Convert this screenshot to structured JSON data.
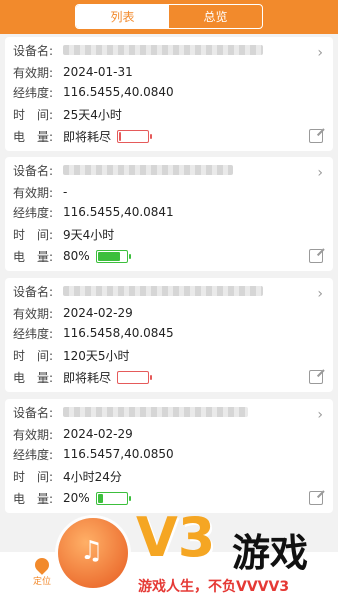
{
  "tabs": [
    {
      "label": "列表",
      "active": true
    },
    {
      "label": "总览",
      "active": false
    }
  ],
  "labels": {
    "device": "设备名:",
    "expiry": "有效期:",
    "coords": "经纬度:",
    "time": "时　间:",
    "battery": "电　量:"
  },
  "devices": [
    {
      "expiry": "2024-01-31",
      "coords": "116.5455,40.0840",
      "time": "25天4小时",
      "battery_text": "即将耗尽",
      "battery_level": 0.08,
      "battery_color": "#e55a5a"
    },
    {
      "expiry": "-",
      "coords": "116.5455,40.0841",
      "time": "9天4小时",
      "battery_text": "80%",
      "battery_level": 0.8,
      "battery_color": "#3cbf3c"
    },
    {
      "expiry": "2024-02-29",
      "coords": "116.5458,40.0845",
      "time": "120天5小时",
      "battery_text": "即将耗尽",
      "battery_level": 0.0,
      "battery_color": "#e55a5a"
    },
    {
      "expiry": "2024-02-29",
      "coords": "116.5457,40.0850",
      "time": "4小时24分",
      "battery_text": "20%",
      "battery_level": 0.2,
      "battery_color": "#3cbf3c"
    }
  ],
  "nav": {
    "locate_label": "定位"
  },
  "watermark": {
    "brand": "V3",
    "title": "游戏",
    "slogan": "游戏人生，不负VVVV3"
  },
  "colors": {
    "accent": "#f28a2c",
    "low_battery": "#e55a5a",
    "ok_battery": "#3cbf3c"
  }
}
